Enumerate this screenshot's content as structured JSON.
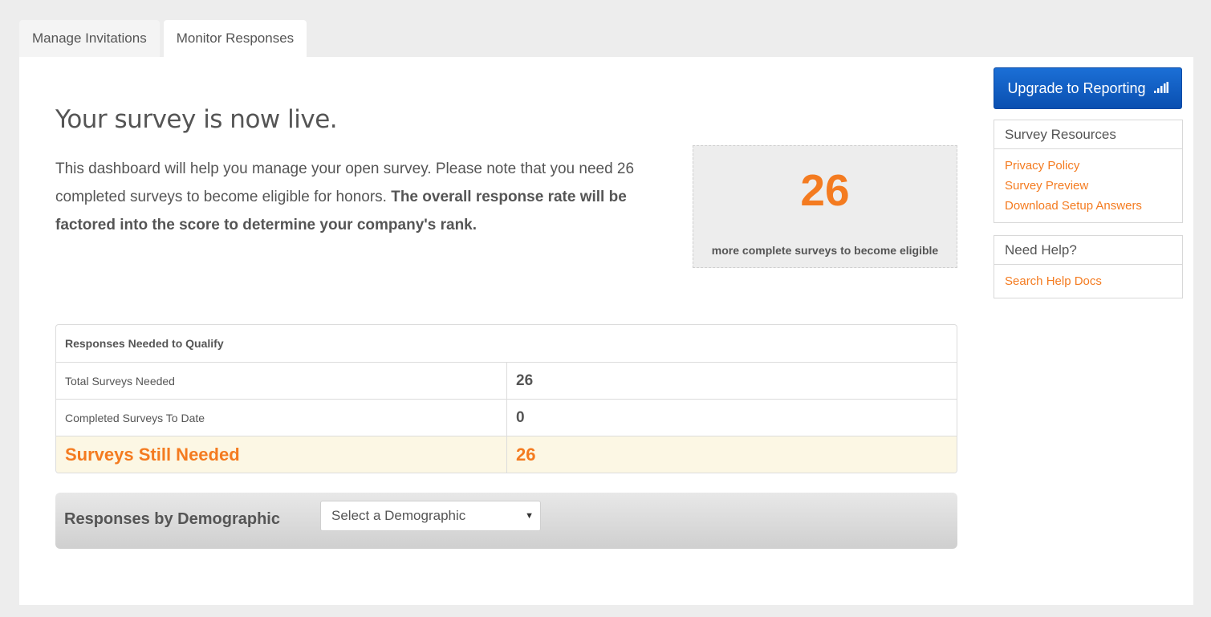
{
  "tabs": [
    {
      "label": "Manage Invitations",
      "active": false
    },
    {
      "label": "Monitor Responses",
      "active": true
    }
  ],
  "main": {
    "headline": "Your survey is now live.",
    "intro_text": "This dashboard will help you manage your open survey. Please note that you need 26 completed surveys to become eligible for honors.",
    "intro_bold": "The overall response rate will be factored into the score to determine your company's rank.",
    "eligible": {
      "number": "26",
      "caption": "more complete surveys to become eligible"
    },
    "table": {
      "header": "Responses Needed to Qualify",
      "rows": [
        {
          "label": "Total Surveys Needed",
          "value": "26"
        },
        {
          "label": "Completed Surveys To Date",
          "value": "0"
        },
        {
          "label": "Surveys Still Needed",
          "value": "26"
        }
      ]
    },
    "demographic": {
      "label": "Responses by Demographic",
      "select_value": "Select a Demographic"
    }
  },
  "sidebar": {
    "upgrade_button": "Upgrade to Reporting",
    "upgrade_icon": "signal-bars-icon",
    "resources": {
      "title": "Survey Resources",
      "links": [
        "Privacy Policy",
        "Survey Preview",
        "Download Setup Answers"
      ]
    },
    "help": {
      "title": "Need Help?",
      "links": [
        "Search Help Docs"
      ]
    }
  },
  "colors": {
    "accent": "#f47b20",
    "button": "#0a5bc4",
    "highlight_row": "#fcf7e4"
  }
}
